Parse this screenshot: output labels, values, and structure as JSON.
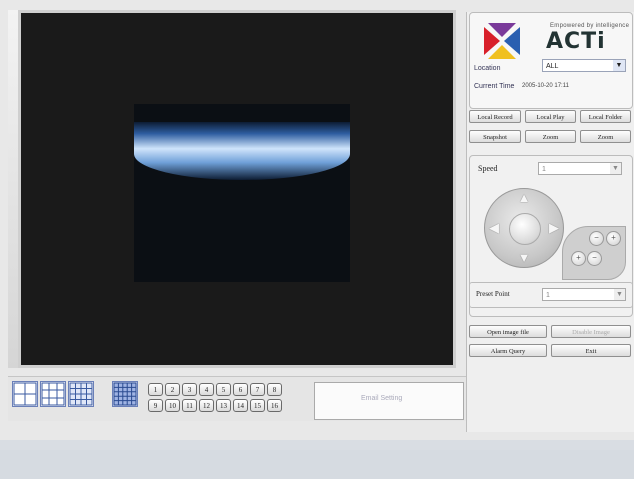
{
  "brand": {
    "tagline": "Empowered by intelligence",
    "name": "ACTi",
    "colors": {
      "red": "#d8202a",
      "blue": "#2a5fb0",
      "purple": "#7a3a9a",
      "yellow": "#f0c020"
    }
  },
  "location": {
    "label": "Location",
    "value": "ALL"
  },
  "current_time": {
    "label": "Current Time",
    "value": "2005-10-20 17:11"
  },
  "buttons_row1": [
    "Local Record",
    "Local Play",
    "Local Folder"
  ],
  "buttons_row2": [
    "Snapshot",
    "Zoom",
    "Zoom"
  ],
  "ptz": {
    "speed_label": "Speed",
    "speed_value": "1"
  },
  "preset": {
    "label": "Preset Point",
    "value": "1"
  },
  "action_buttons": {
    "open": "Open image file",
    "disabled": "Disable Image",
    "alarm": "Alarm Query",
    "exit": "Exit"
  },
  "channels": [
    "1",
    "2",
    "3",
    "4",
    "5",
    "6",
    "7",
    "8",
    "9",
    "10",
    "11",
    "12",
    "13",
    "14",
    "15",
    "16"
  ],
  "status": {
    "text": "Email Setting"
  }
}
